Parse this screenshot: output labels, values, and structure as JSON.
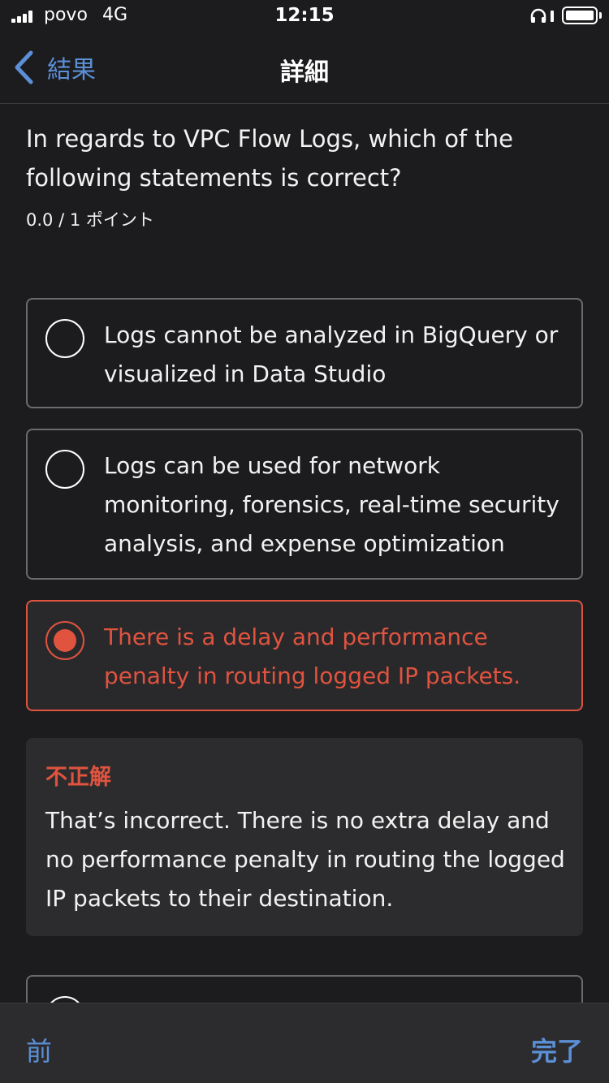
{
  "status_bar": {
    "carrier": "povo",
    "network": "4G",
    "time": "12:15"
  },
  "nav": {
    "back_label": "結果",
    "title": "詳細"
  },
  "question": {
    "text": "In regards to VPC Flow Logs, which of the following statements is correct?",
    "points": "0.0 / 1 ポイント"
  },
  "options": [
    {
      "text": "Logs cannot be analyzed in BigQuery or visualized in Data Studio",
      "selected": false
    },
    {
      "text": "Logs can be used for network monitoring, forensics, real-time security analysis, and expense optimization",
      "selected": false
    },
    {
      "text": "There is a delay and performance penalty in routing logged IP packets.",
      "selected": true
    },
    {
      "text": "",
      "selected": false
    }
  ],
  "feedback": {
    "title": "不正解",
    "text": "That’s incorrect. There is no extra delay and no performance penalty in routing the logged IP packets to their destination."
  },
  "toolbar": {
    "prev_label": "前",
    "done_label": "完了"
  },
  "colors": {
    "accent": "#5b8fd6",
    "incorrect": "#e0533f",
    "background": "#1c1c1e"
  }
}
